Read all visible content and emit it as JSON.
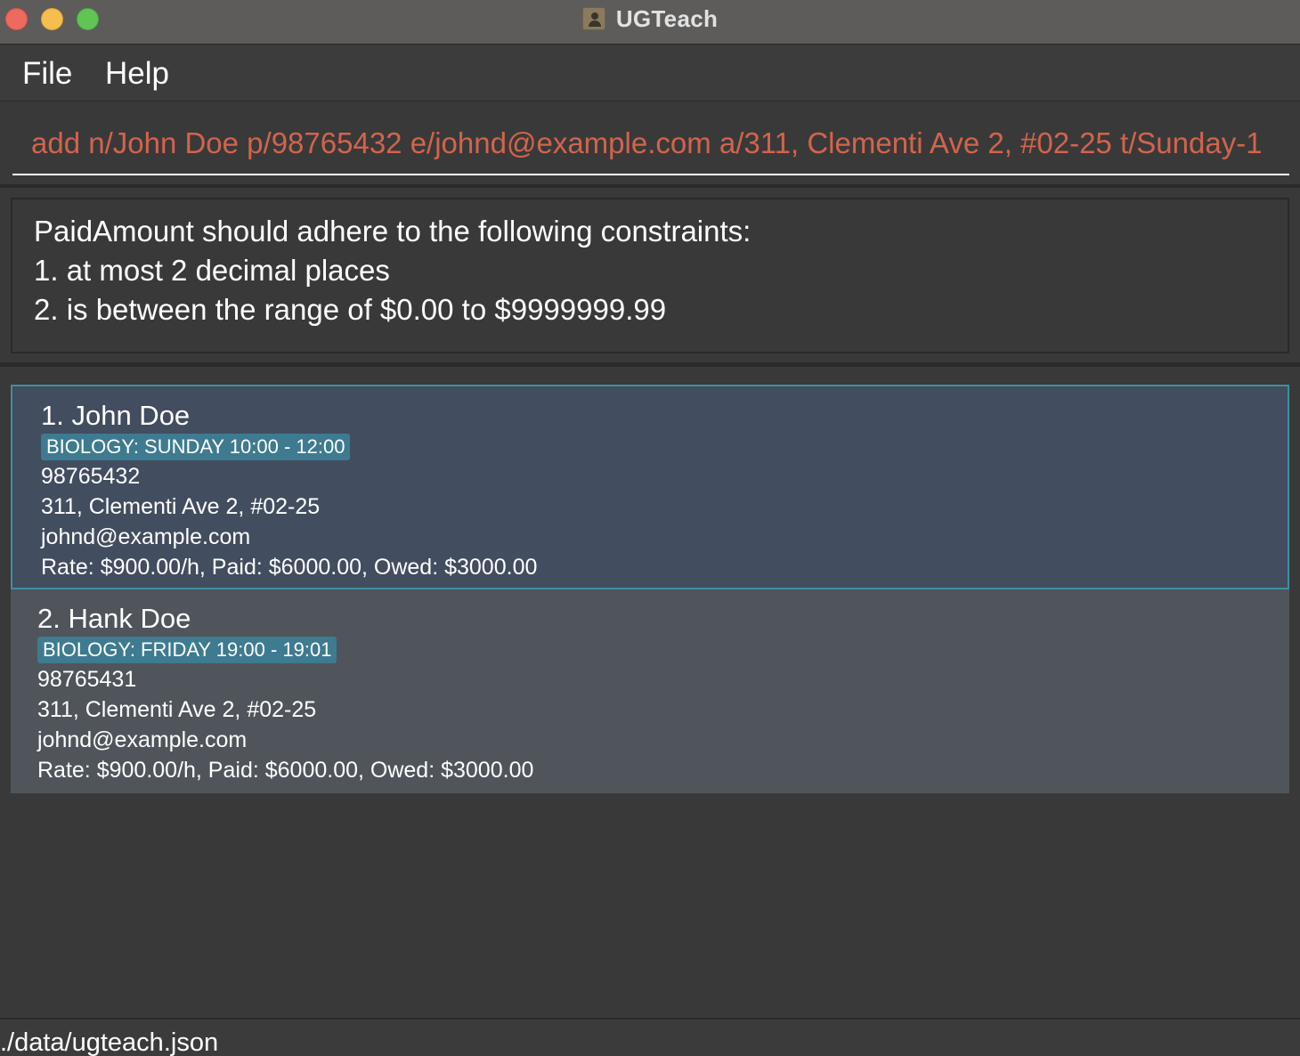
{
  "window": {
    "title": "UGTeach",
    "icon": "app-contacts-icon"
  },
  "menu": {
    "items": [
      {
        "label": "File"
      },
      {
        "label": "Help"
      }
    ]
  },
  "command_box": {
    "value": "add n/John Doe p/98765432 e/johnd@example.com a/311, Clementi Ave 2, #02-25 t/Sunday-1"
  },
  "result_display": {
    "lines": [
      "PaidAmount should adhere to the following constraints:",
      "1. at most 2 decimal places",
      "2. is between the range of $0.00 to $9999999.99"
    ]
  },
  "persons": [
    {
      "name": "1. John Doe",
      "tag": "BIOLOGY: SUNDAY 10:00 - 12:00",
      "phone": "98765432",
      "address": "311, Clementi Ave 2, #02-25",
      "email": "johnd@example.com",
      "payment": "Rate: $900.00/h, Paid: $6000.00, Owed: $3000.00",
      "selected": true
    },
    {
      "name": "2. Hank Doe",
      "tag": "BIOLOGY: FRIDAY 19:00 - 19:01",
      "phone": "98765431",
      "address": "311, Clementi Ave 2, #02-25",
      "email": "johnd@example.com",
      "payment": "Rate: $900.00/h, Paid: $6000.00, Owed: $3000.00",
      "selected": false
    }
  ],
  "status_bar": {
    "file_path": "./data/ugteach.json"
  },
  "colors": {
    "accent_command_text": "#d2644c",
    "tag_background": "#3e7b91",
    "selected_card_background": "#424d5f",
    "selected_card_border": "#3d8fa3",
    "card_background": "#4f555b"
  }
}
